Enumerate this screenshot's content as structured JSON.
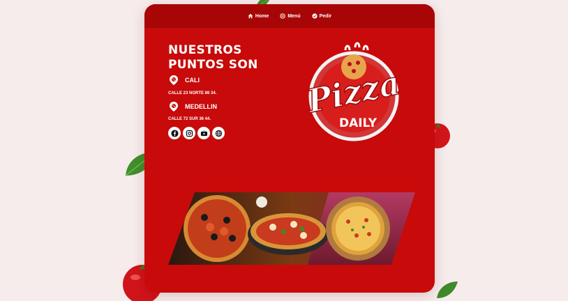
{
  "nav": {
    "items": [
      {
        "label": "Home",
        "icon": "home-icon"
      },
      {
        "label": "Menú",
        "icon": "menu-icon"
      },
      {
        "label": "Pedir",
        "icon": "order-icon"
      }
    ]
  },
  "locations": {
    "title": "NUESTROS PUNTOS SON",
    "cities": [
      {
        "name": "CALI",
        "address": "CALLE 23 NORTE 86 34.",
        "icon": "pizza-pin-icon"
      },
      {
        "name": "MEDELLIN",
        "address": "CALLE 72 SUR 36 44.",
        "icon": "pizza-pin-icon"
      }
    ]
  },
  "socials": [
    {
      "name": "facebook",
      "icon": "facebook-icon"
    },
    {
      "name": "instagram",
      "icon": "instagram-icon"
    },
    {
      "name": "youtube",
      "icon": "youtube-icon"
    },
    {
      "name": "web",
      "icon": "globe-icon"
    }
  ],
  "logo": {
    "line1": "Pizza",
    "line2": "DAILY"
  },
  "colors": {
    "brand_red": "#c80a0a",
    "nav_red": "#a80606",
    "background": "#f6ecec"
  }
}
